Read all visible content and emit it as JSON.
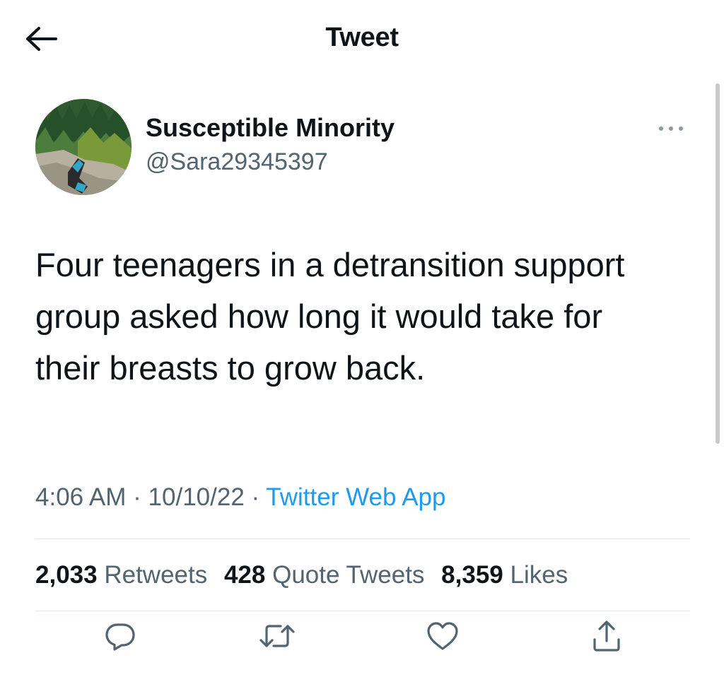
{
  "header": {
    "title": "Tweet",
    "back_icon": "arrow-left-icon"
  },
  "tweet": {
    "author": {
      "display_name": "Susceptible Minority",
      "handle": "@Sara29345397"
    },
    "text": "Four teenagers in a detransition support group asked how long it would take for their breasts to grow back.",
    "time": "4:06 AM",
    "date": "10/10/22",
    "separator": "·",
    "source": "Twitter Web App",
    "stats": {
      "retweets_count": "2,033",
      "retweets_label": "Retweets",
      "quotes_count": "428",
      "quotes_label": "Quote Tweets",
      "likes_count": "8,359",
      "likes_label": "Likes"
    },
    "actions": [
      "reply-icon",
      "retweet-icon",
      "like-icon",
      "share-icon"
    ]
  },
  "colors": {
    "text": "#0f1419",
    "secondary": "#536471",
    "link": "#1d9bf0",
    "divider": "#e1e8ed"
  }
}
